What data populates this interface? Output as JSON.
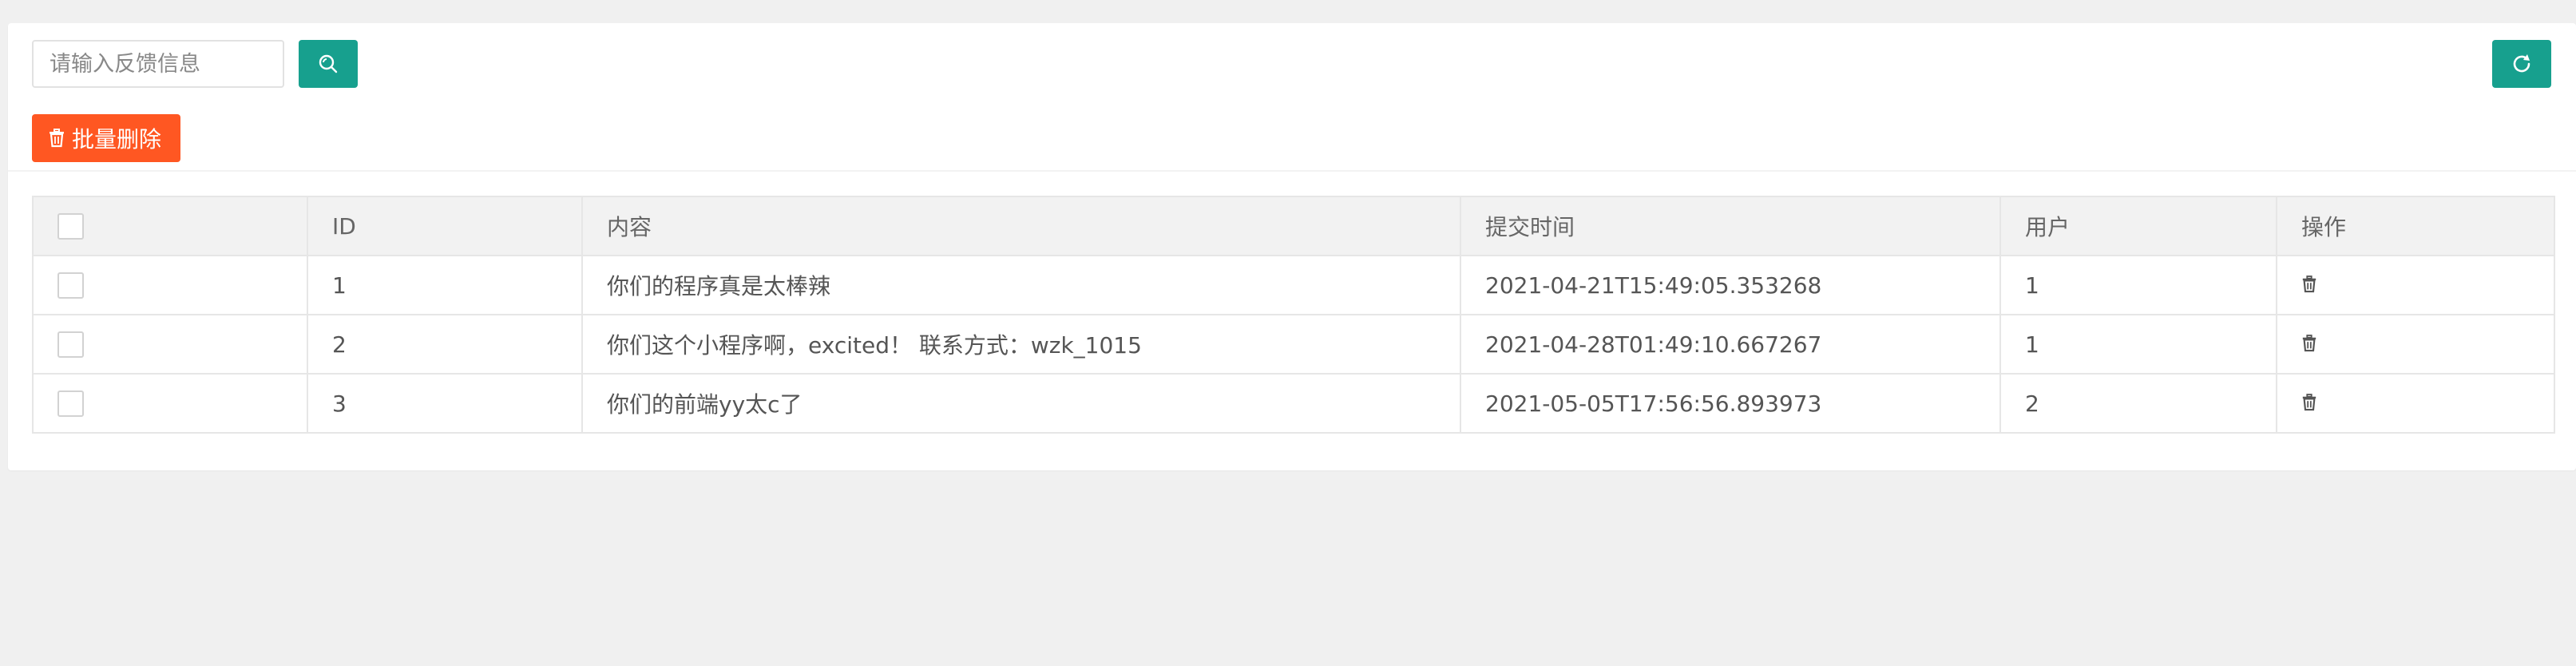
{
  "toolbar": {
    "search_placeholder": "请输入反馈信息",
    "search_value": "",
    "search_button_icon": "search-icon",
    "refresh_button_icon": "refresh-icon",
    "batch_delete_label": "批量删除",
    "batch_delete_icon": "trash-icon"
  },
  "table": {
    "columns": [
      "",
      "ID",
      "内容",
      "提交时间",
      "用户",
      "操作"
    ],
    "rows": [
      {
        "id": "1",
        "content": "你们的程序真是太棒辣",
        "time": "2021-04-21T15:49:05.353268",
        "user": "1",
        "action_icon": "trash-icon"
      },
      {
        "id": "2",
        "content": "你们这个小程序啊，excited！ 联系方式：wzk_1015",
        "time": "2021-04-28T01:49:10.667267",
        "user": "1",
        "action_icon": "trash-icon"
      },
      {
        "id": "3",
        "content": "你们的前端yy太c了",
        "time": "2021-05-05T17:56:56.893973",
        "user": "2",
        "action_icon": "trash-icon"
      }
    ]
  },
  "colors": {
    "primary": "#17a08e",
    "danger": "#ff5722",
    "header_bg": "#f2f2f2",
    "page_bg": "#f0f0f0"
  }
}
